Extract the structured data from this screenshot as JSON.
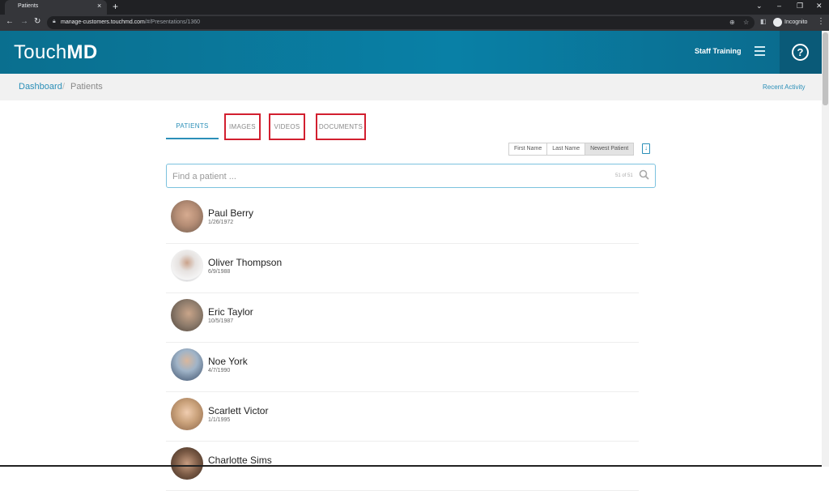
{
  "browser": {
    "tab_title": "Patients",
    "tab_close": "×",
    "new_tab": "+",
    "url_domain": "manage-customers.touchmd.com",
    "url_path": "/#/Presentations/1360",
    "incognito_label": "Incognito"
  },
  "header": {
    "logo_light": "Touch",
    "logo_bold": "MD",
    "user_label": "Staff Training",
    "help_glyph": "?"
  },
  "breadcrumb": {
    "dashboard": "Dashboard",
    "separator": "/",
    "current": "Patients",
    "recent_activity": "Recent Activity"
  },
  "tabs": [
    {
      "label": "PATIENTS",
      "active": true
    },
    {
      "label": "IMAGES",
      "highlighted": true
    },
    {
      "label": "VIDEOS",
      "highlighted": true
    },
    {
      "label": "DOCUMENTS",
      "highlighted": true
    }
  ],
  "sort": {
    "first_name": "First Name",
    "last_name": "Last Name",
    "newest_patient": "Newest Patient",
    "selected": "Newest Patient"
  },
  "search": {
    "placeholder": "Find a patient ...",
    "count": "51 of 51"
  },
  "patients": [
    {
      "name": "Paul Berry",
      "dob": "1/26/1972",
      "avatar_color": "#b58d75"
    },
    {
      "name": "Oliver Thompson",
      "dob": "6/9/1988",
      "avatar_color": "#e6e2e0"
    },
    {
      "name": "Eric Taylor",
      "dob": "10/5/1987",
      "avatar_color": "#8c7a6a"
    },
    {
      "name": "Noe York",
      "dob": "4/7/1990",
      "avatar_color": "#6b7f96"
    },
    {
      "name": "Scarlett Victor",
      "dob": "1/1/1995",
      "avatar_color": "#c9a17a"
    },
    {
      "name": "Charlotte Sims",
      "dob": "",
      "avatar_color": "#7a5a45"
    }
  ],
  "colors": {
    "header": "#0980a6",
    "accent": "#2b8fb8",
    "highlight_box": "#d21f2f"
  }
}
